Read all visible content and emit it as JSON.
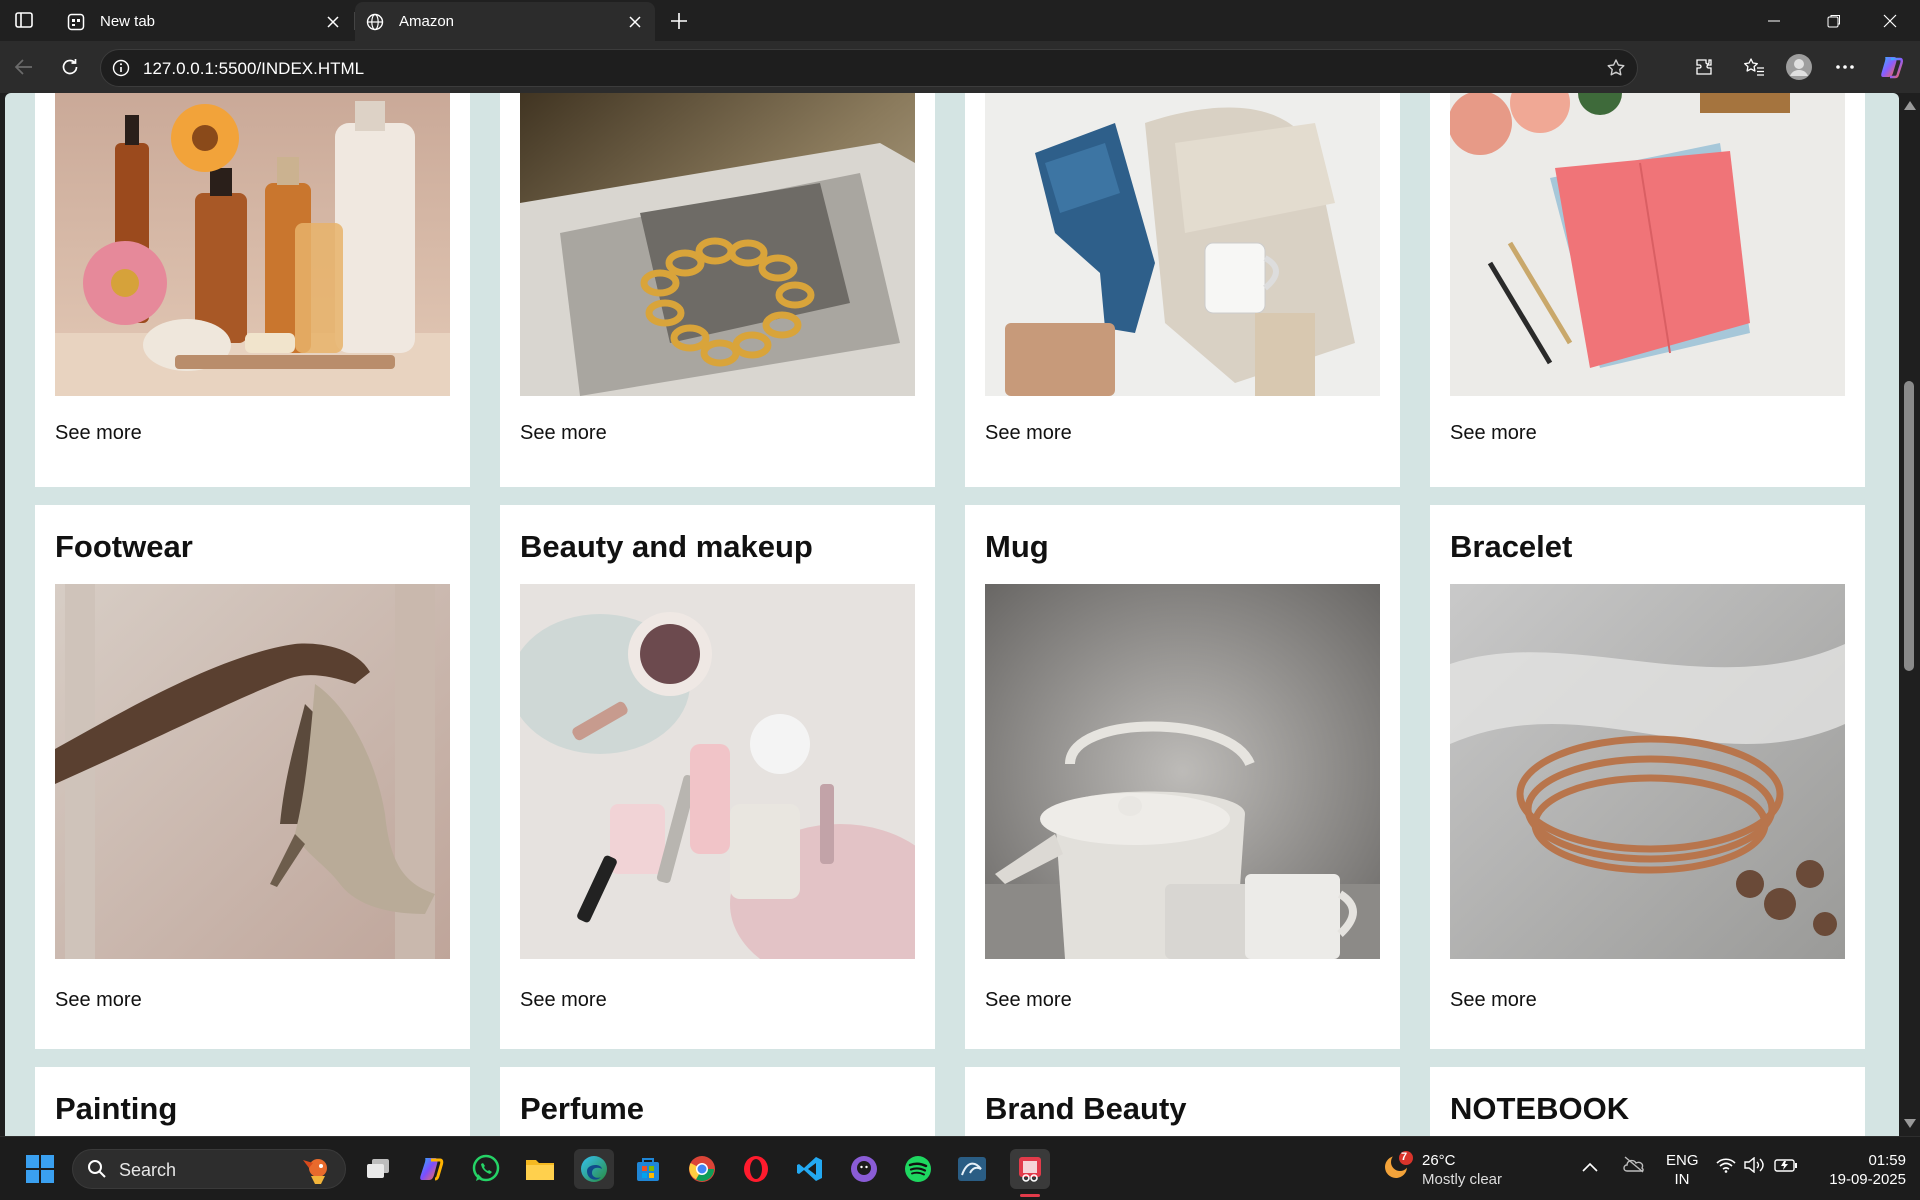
{
  "browser": {
    "tabs": [
      {
        "label": "New tab",
        "icon": "new-tab-page-icon",
        "active": false
      },
      {
        "label": "Amazon",
        "icon": "globe-icon",
        "active": true
      }
    ],
    "url": "127.0.0.1:5500/INDEX.HTML"
  },
  "page": {
    "top_row": [
      {
        "see_more": "See more",
        "image": "perfume bottles with flowers"
      },
      {
        "see_more": "See more",
        "image": "gold chain bracelet on magazine"
      },
      {
        "see_more": "See more",
        "image": "jeans sweater and mug flatlay"
      },
      {
        "see_more": "See more",
        "image": "pink notebook with roses"
      }
    ],
    "mid_row": [
      {
        "title": "Footwear",
        "see_more": "See more",
        "image": "hand holding high heel shoe"
      },
      {
        "title": "Beauty and makeup",
        "see_more": "See more",
        "image": "makeup products flatlay"
      },
      {
        "title": "Mug",
        "see_more": "See more",
        "image": "white teapot and mugs"
      },
      {
        "title": "Bracelet",
        "see_more": "See more",
        "image": "rose gold bangles"
      }
    ],
    "bottom_row": [
      {
        "title": "Painting"
      },
      {
        "title": "Perfume"
      },
      {
        "title": "Brand Beauty"
      },
      {
        "title": "NOTEBOOK"
      }
    ],
    "background_color": "#d4e4e3"
  },
  "taskbar": {
    "search_label": "Search",
    "weather": {
      "temp": "26°C",
      "desc": "Mostly clear",
      "badge": "7"
    },
    "language": {
      "line1": "ENG",
      "line2": "IN"
    },
    "clock": {
      "time": "01:59",
      "date": "19-09-2025"
    }
  }
}
